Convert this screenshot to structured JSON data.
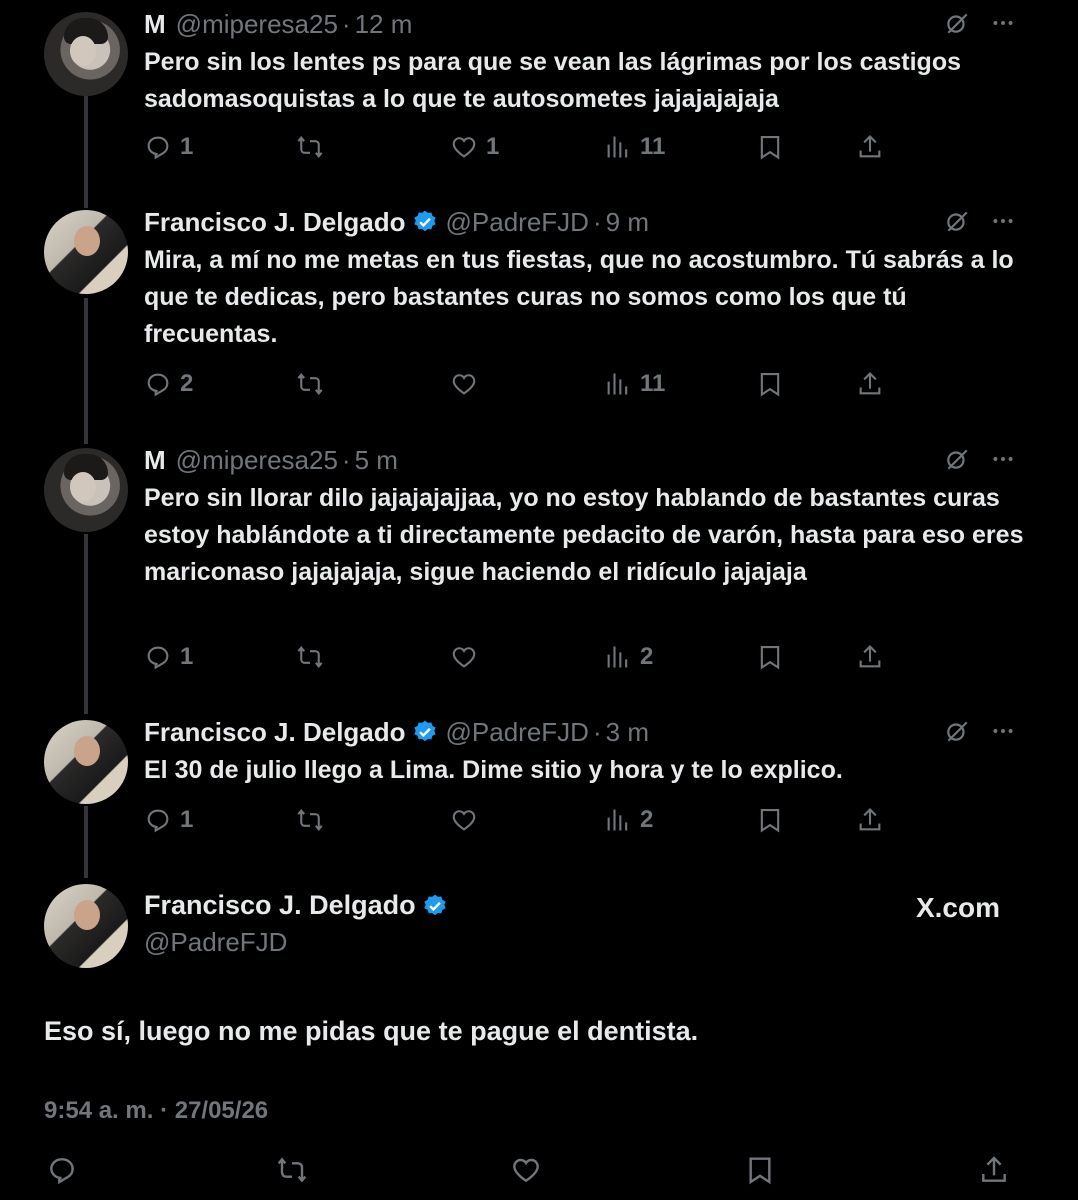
{
  "tweets": [
    {
      "name": "M",
      "handle": "@miperesa25",
      "time": "12 m",
      "verified": false,
      "text": "Pero sin los lentes ps para que se vean las lágrimas por los castigos sadomasoquistas a lo que te autosometes jajajajajaja",
      "replies": "1",
      "retweets": "",
      "likes": "1",
      "views": "11"
    },
    {
      "name": "Francisco J. Delgado",
      "handle": "@PadreFJD",
      "time": "9 m",
      "verified": true,
      "text": "Mira, a mí no me metas en tus fiestas, que no acostumbro. Tú sabrás a lo que te dedicas, pero bastantes curas no somos como los que tú frecuentas.",
      "replies": "2",
      "retweets": "",
      "likes": "",
      "views": "11"
    },
    {
      "name": "M",
      "handle": "@miperesa25",
      "time": "5 m",
      "verified": false,
      "text": "Pero sin llorar dilo jajajajajjaa, yo no estoy hablando de bastantes curas estoy hablándote a ti directamente pedacito de varón, hasta para eso eres mariconaso jajajajaja, sigue haciendo el ridículo jajajaja",
      "replies": "1",
      "retweets": "",
      "likes": "",
      "views": "2"
    },
    {
      "name": "Francisco J. Delgado",
      "handle": "@PadreFJD",
      "time": "3 m",
      "verified": true,
      "text": "El 30 de julio llego a Lima. Dime sitio y hora y te lo explico.",
      "replies": "1",
      "retweets": "",
      "likes": "",
      "views": "2"
    }
  ],
  "main": {
    "name": "Francisco J. Delgado",
    "handle": "@PadreFJD",
    "site": "X.com",
    "text": "Eso sí, luego no me pidas que te pague el dentista.",
    "timestamp": "9:54 a. m. · 27/05/26"
  },
  "colors": {
    "background": "#000000",
    "text": "#e7e9ea",
    "muted": "#71767b",
    "verified": "#1d9bf0"
  },
  "icons": [
    "reply-icon",
    "retweet-icon",
    "like-icon",
    "views-icon",
    "bookmark-icon",
    "share-icon",
    "grok-icon",
    "more-icon",
    "verified-badge-icon"
  ]
}
